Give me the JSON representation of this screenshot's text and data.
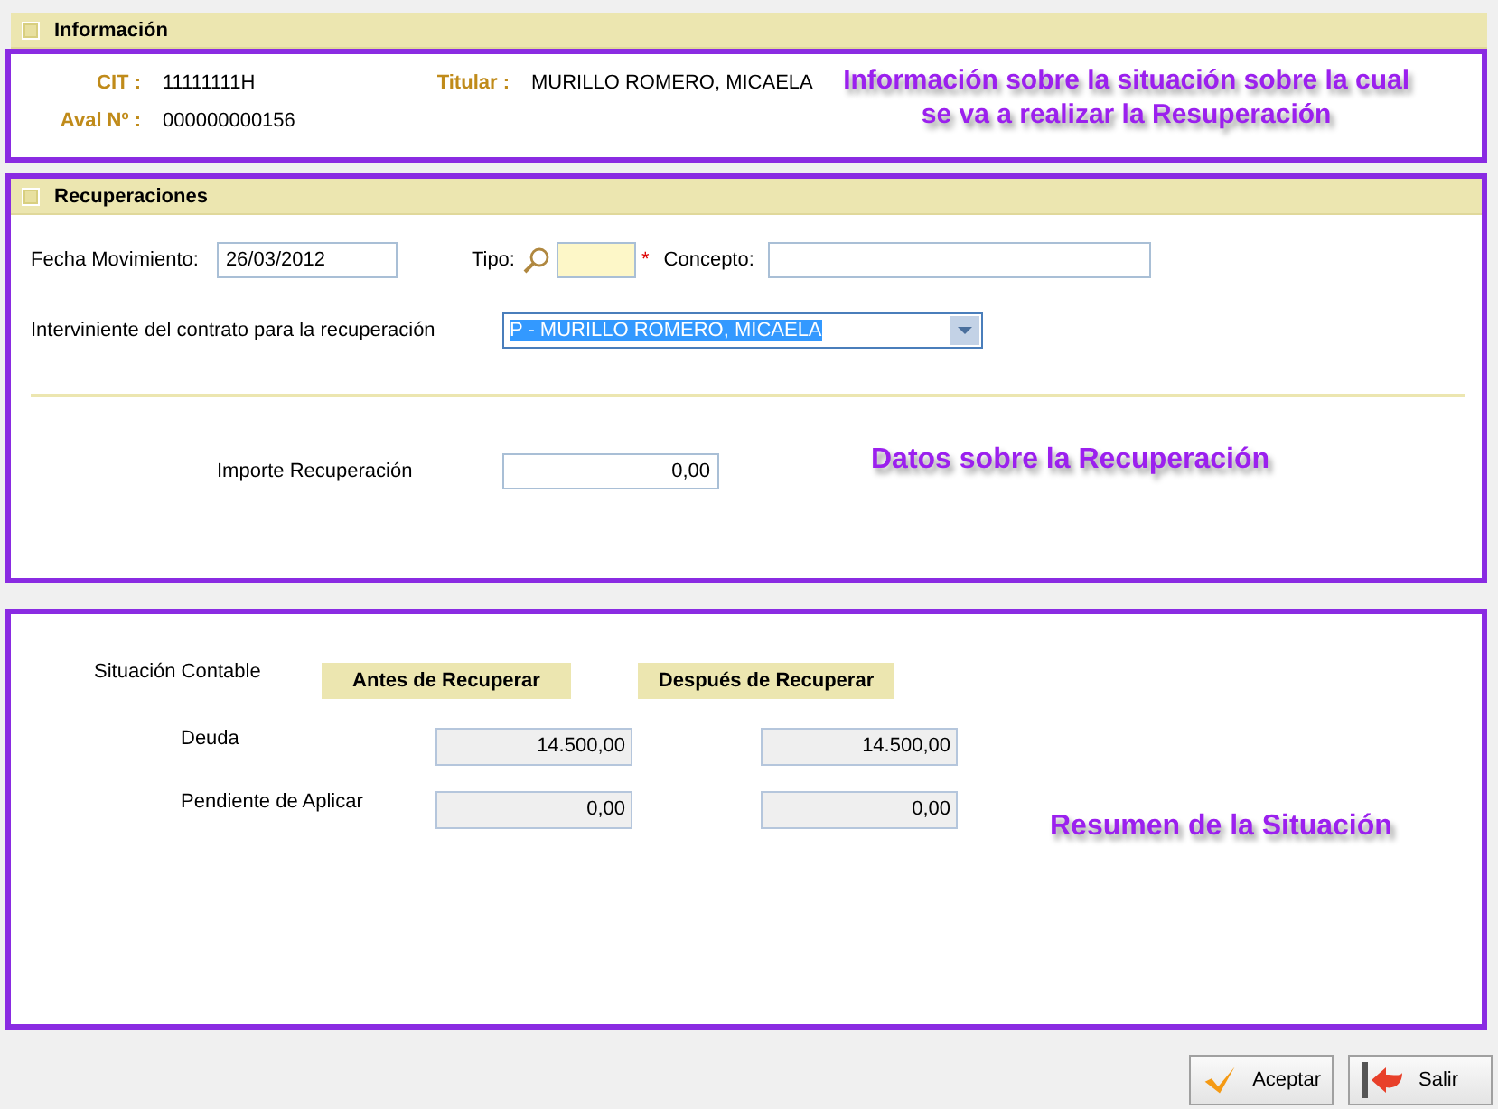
{
  "informacion": {
    "title": "Información",
    "cit": {
      "label": "CIT :",
      "value": "11111111H"
    },
    "titular": {
      "label": "Titular :",
      "value": "MURILLO ROMERO, MICAELA"
    },
    "aval": {
      "label": "Aval Nº :",
      "value": "000000000156"
    },
    "annotation": [
      "Información sobre la situación sobre la cual",
      "se va a realizar la Resuperación"
    ]
  },
  "recuperaciones": {
    "title": "Recuperaciones",
    "fecha": {
      "label": "Fecha Movimiento:",
      "value": "26/03/2012"
    },
    "tipo": {
      "label": "Tipo:",
      "required_mark": "*"
    },
    "concepto": {
      "label": "Concepto:"
    },
    "interviniente": {
      "label": "Interviniente del contrato para la recuperación",
      "value": "P - MURILLO ROMERO, MICAELA"
    },
    "importe": {
      "label": "Importe Recuperación",
      "value": "0,00"
    },
    "annotation": "Datos sobre la Recuperación"
  },
  "resumen": {
    "title": "Situación Contable",
    "columns": [
      "Antes de Recuperar",
      "Después de Recuperar"
    ],
    "rows": [
      {
        "label": "Deuda",
        "values": [
          "14.500,00",
          "14.500,00"
        ]
      },
      {
        "label": "Pendiente de Aplicar",
        "values": [
          "0,00",
          "0,00"
        ]
      }
    ],
    "annotation": "Resumen de la Situación"
  },
  "buttons": [
    {
      "label": "Aceptar",
      "kind": "accept"
    },
    {
      "label": "Salir",
      "kind": "exit"
    }
  ]
}
